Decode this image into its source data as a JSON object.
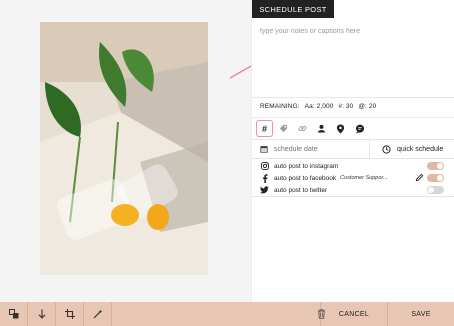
{
  "panel": {
    "tab_label": "SCHEDULE POST",
    "notes_placeholder": "type your notes or captions here",
    "remaining": {
      "label": "REMAINING:",
      "chars": "Aa: 2,000",
      "hashtags": "#: 30",
      "mentions": "@: 20"
    },
    "toolbar": {
      "icons": [
        "hashtag-icon",
        "tag-icon",
        "link-icon",
        "user-icon",
        "location-pin-icon",
        "comment-icon"
      ],
      "active": "hashtag-icon"
    },
    "schedule": {
      "date_placeholder": "schedule date",
      "quick_label": "quick schedule"
    },
    "auto_posts": [
      {
        "label": "auto post to instagram",
        "icon": "instagram-icon",
        "enabled": true
      },
      {
        "label": "auto post to facebook",
        "sub": "Customer Suppor...",
        "icon": "facebook-icon",
        "enabled": true
      },
      {
        "label": "auto post to twitter",
        "icon": "twitter-icon",
        "enabled": false
      }
    ]
  },
  "bottom_bar": {
    "cancel_label": "CANCEL",
    "save_label": "SAVE"
  },
  "colors": {
    "accent_bar": "#e8c6b4",
    "toggle_on": "#e2b8a4",
    "toggle_off": "#d6d6d6",
    "highlight": "#ef8fb0",
    "tab_bg": "#222222"
  }
}
